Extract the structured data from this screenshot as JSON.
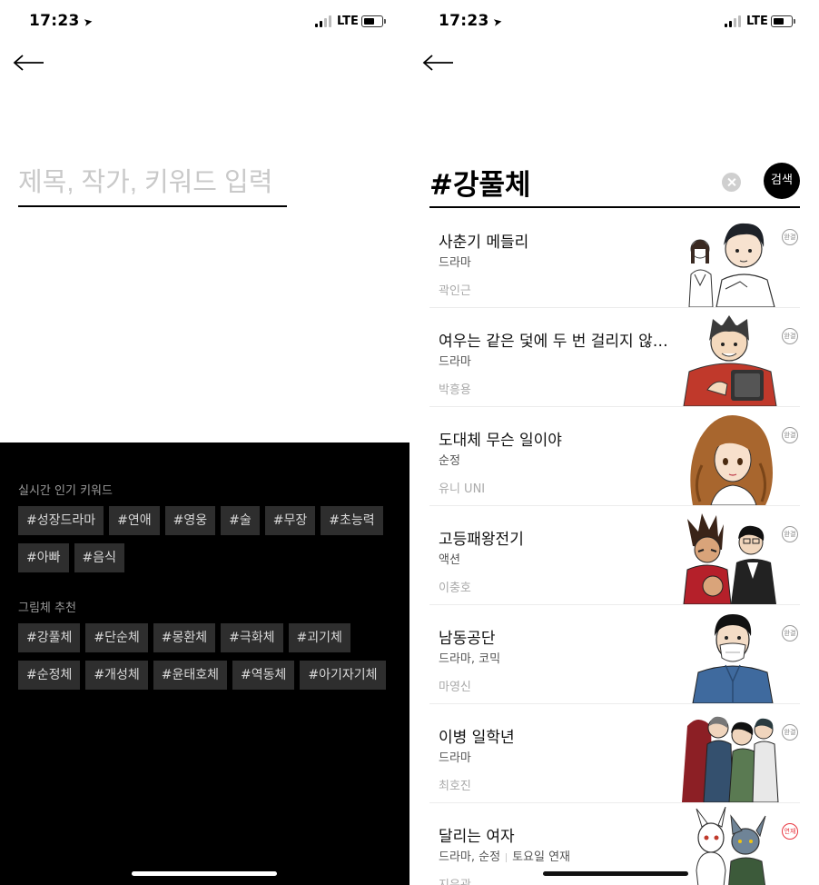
{
  "left": {
    "status": {
      "time": "17:23",
      "network": "LTE"
    },
    "search_placeholder": "제목, 작가, 키워드 입력",
    "trending": {
      "title": "실시간 인기 키워드",
      "tags": [
        "#성장드라마",
        "#연애",
        "#영웅",
        "#술",
        "#무장",
        "#초능력",
        "#아빠",
        "#음식"
      ]
    },
    "styles": {
      "title": "그림체 추천",
      "tags": [
        "#강풀체",
        "#단순체",
        "#몽환체",
        "#극화체",
        "#괴기체",
        "#순정체",
        "#개성체",
        "#윤태호체",
        "#역동체",
        "#아기자기체"
      ]
    }
  },
  "right": {
    "status": {
      "time": "17:23",
      "network": "LTE"
    },
    "query": "#강풀체",
    "search_button": "검색",
    "results": [
      {
        "title": "사춘기 메들리",
        "genre": "드라마",
        "schedule": "",
        "author": "곽인근",
        "badge": "완결",
        "badge_color": "#9a9a9a",
        "thumb": "two-students"
      },
      {
        "title": "여우는 같은 덫에 두 번 걸리지 않…",
        "genre": "드라마",
        "schedule": "",
        "author": "박흥용",
        "badge": "완결",
        "badge_color": "#9a9a9a",
        "thumb": "man-red-jacket"
      },
      {
        "title": "도대체 무슨 일이야",
        "genre": "순정",
        "schedule": "",
        "author": "유니 UNI",
        "badge": "완결",
        "badge_color": "#9a9a9a",
        "thumb": "curly-hair-woman"
      },
      {
        "title": "고등패왕전기",
        "genre": "액션",
        "schedule": "",
        "author": "이충호",
        "badge": "완결",
        "badge_color": "#9a9a9a",
        "thumb": "fighters"
      },
      {
        "title": "남동공단",
        "genre": "드라마, 코믹",
        "schedule": "",
        "author": "마영신",
        "badge": "완결",
        "badge_color": "#9a9a9a",
        "thumb": "masked-man"
      },
      {
        "title": "이병 일학년",
        "genre": "드라마",
        "schedule": "",
        "author": "최호진",
        "badge": "완결",
        "badge_color": "#9a9a9a",
        "thumb": "group"
      },
      {
        "title": "달리는 여자",
        "genre": "드라마, 순정",
        "schedule": "토요일 연재",
        "author": "지은광",
        "badge": "연재",
        "badge_color": "#e8363f",
        "thumb": "animals"
      }
    ]
  }
}
